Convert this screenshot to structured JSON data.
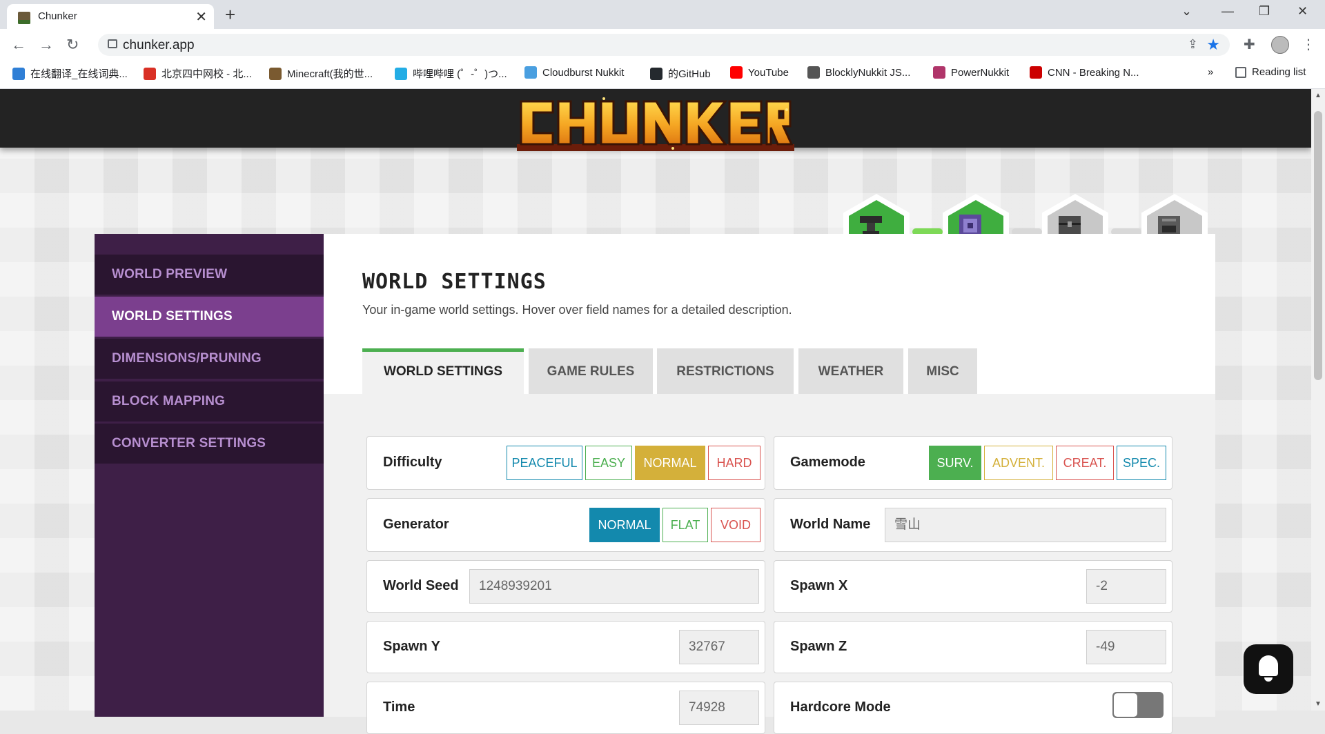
{
  "browser": {
    "tab_title": "Chunker",
    "url": "chunker.app",
    "reading_list": "Reading list",
    "more_bookmarks": "»",
    "bookmarks": [
      {
        "label": "在线翻译_在线词典...",
        "color": "#2f7fd6"
      },
      {
        "label": "北京四中网校 - 北...",
        "color": "#d93025"
      },
      {
        "label": "Minecraft(我的世...",
        "color": "#7a5a30"
      },
      {
        "label": "哔哩哔哩 (゜-゜)つ...",
        "color": "#23ade5"
      },
      {
        "label": "Cloudburst Nukkit",
        "color": "#4a9fe0"
      },
      {
        "label": "的GitHub",
        "color": "#24292e"
      },
      {
        "label": "YouTube",
        "color": "#ff0000"
      },
      {
        "label": "BlocklyNukkit JS...",
        "color": "#555555"
      },
      {
        "label": "PowerNukkit",
        "color": "#b0356a"
      },
      {
        "label": "CNN - Breaking N...",
        "color": "#cc0000"
      }
    ]
  },
  "sidebar": {
    "items": [
      {
        "label": "WORLD PREVIEW"
      },
      {
        "label": "WORLD SETTINGS",
        "active": true
      },
      {
        "label": "DIMENSIONS/PRUNING"
      },
      {
        "label": "BLOCK MAPPING"
      },
      {
        "label": "CONVERTER SETTINGS"
      }
    ]
  },
  "main": {
    "title": "WORLD SETTINGS",
    "subtitle": "Your in-game world settings. Hover over field names for a detailed description.",
    "tabs": [
      {
        "label": "WORLD SETTINGS",
        "active": true
      },
      {
        "label": "GAME RULES"
      },
      {
        "label": "RESTRICTIONS"
      },
      {
        "label": "WEATHER"
      },
      {
        "label": "MISC"
      }
    ]
  },
  "settings": {
    "difficulty": {
      "label": "Difficulty",
      "options": [
        "PEACEFUL",
        "EASY",
        "NORMAL",
        "HARD"
      ],
      "selected": "NORMAL"
    },
    "gamemode": {
      "label": "Gamemode",
      "options": [
        "SURV.",
        "ADVENT.",
        "CREAT.",
        "SPEC."
      ],
      "selected": "SURV."
    },
    "generator": {
      "label": "Generator",
      "options": [
        "NORMAL",
        "FLAT",
        "VOID"
      ],
      "selected": "NORMAL"
    },
    "world_name": {
      "label": "World Name",
      "value": "雪山"
    },
    "world_seed": {
      "label": "World Seed",
      "value": "1248939201"
    },
    "spawn_x": {
      "label": "Spawn X",
      "value": "-2"
    },
    "spawn_y": {
      "label": "Spawn Y",
      "value": "32767"
    },
    "spawn_z": {
      "label": "Spawn Z",
      "value": "-49"
    },
    "time": {
      "label": "Time",
      "value": "74928"
    },
    "hardcore": {
      "label": "Hardcore Mode",
      "enabled": false
    }
  },
  "colors": {
    "brand_purple": "#7b3f8e",
    "green": "#4caf50",
    "gold": "#d4b03a",
    "blue": "#1389ad",
    "red": "#d9534f"
  }
}
